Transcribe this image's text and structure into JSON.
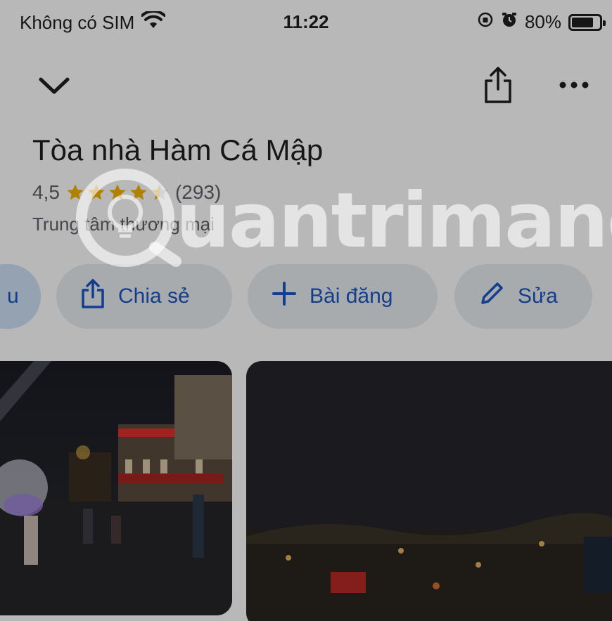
{
  "status_bar": {
    "carrier": "Không có SIM",
    "time": "11:22",
    "battery_percent": "80%",
    "battery_level": 0.8,
    "icons": [
      "wifi-icon",
      "orientation-lock-icon",
      "alarm-icon",
      "battery-icon"
    ]
  },
  "header": {
    "icons": [
      "chevron-down-icon",
      "share-icon",
      "more-icon"
    ]
  },
  "place": {
    "title": "Tòa nhà Hàm Cá Mập",
    "rating": "4,5",
    "rating_value": 4.5,
    "stars_max": 5,
    "review_count": "(293)",
    "category": "Trung tâm thương mại"
  },
  "chips": {
    "partial_label": "u",
    "share_label": "Chia sẻ",
    "post_label": "Bài đăng",
    "edit_label": "Sửa"
  },
  "watermark": {
    "text": "uantrimang"
  },
  "colors": {
    "accent": "#1a57c4",
    "chip_bg": "#e9edf2",
    "star": "#f4b400",
    "text_primary": "#1f1f1f",
    "text_secondary": "#5f6368"
  }
}
